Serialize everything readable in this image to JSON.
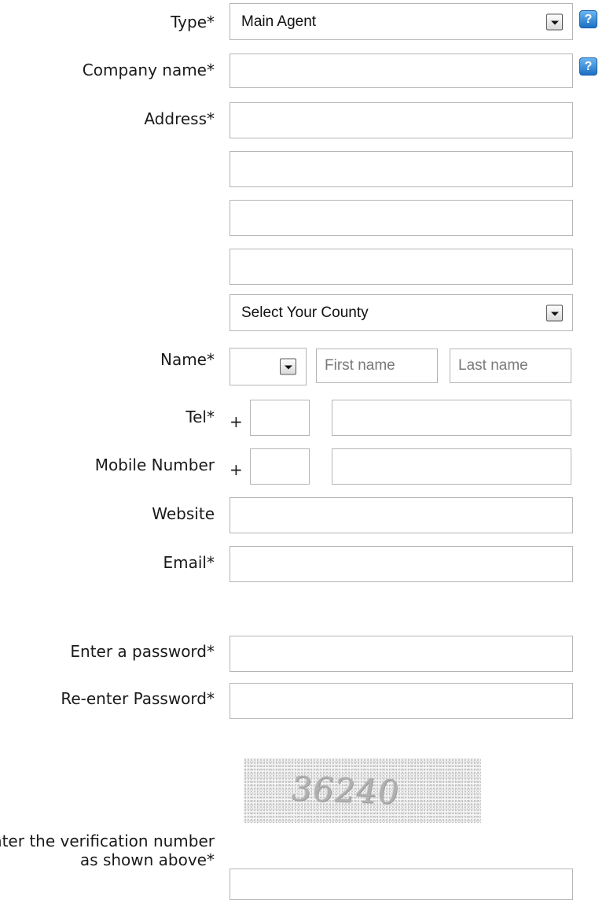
{
  "type_row": {
    "label": "Type*",
    "selected": "Main Agent",
    "help": "?"
  },
  "company_row": {
    "label": "Company name*",
    "value": "",
    "help": "?"
  },
  "address_row": {
    "label": "Address*",
    "lines": [
      "",
      "",
      "",
      ""
    ],
    "county_selected": "Select Your County"
  },
  "name_row": {
    "label": "Name*",
    "title_selected": "",
    "first_placeholder": "First name",
    "last_placeholder": "Last name"
  },
  "tel_row": {
    "label": "Tel*",
    "plus": "+",
    "code": "",
    "number": ""
  },
  "mobile_row": {
    "label": "Mobile Number",
    "plus": "+",
    "code": "",
    "number": ""
  },
  "website_row": {
    "label": "Website",
    "value": ""
  },
  "email_row": {
    "label": "Email*",
    "value": ""
  },
  "password_row": {
    "label": "Enter a password*",
    "value": ""
  },
  "reenter_row": {
    "label": "Re-enter Password*",
    "value": ""
  },
  "captcha": {
    "text": "36240",
    "label": "Enter the verification number as shown above*",
    "value": ""
  },
  "icons": {
    "help": "help-question-icon",
    "dropdown": "chevron-down-icon"
  },
  "colors": {
    "help_bg": "#1c6fc4",
    "border": "#b5b5b5"
  }
}
